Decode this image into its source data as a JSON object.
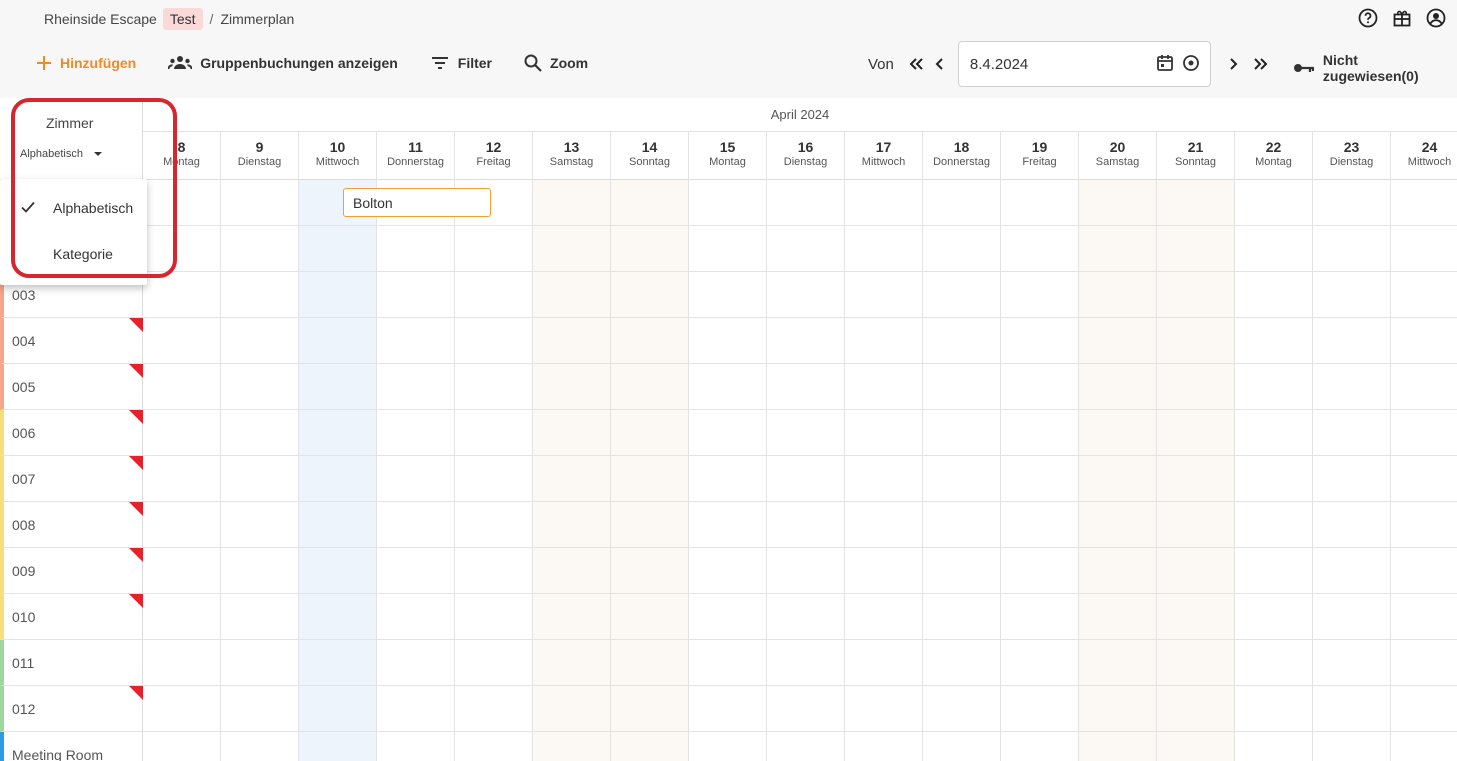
{
  "breadcrumb": {
    "org": "Rheinside Escape",
    "badge": "Test",
    "separator": "/",
    "page": "Zimmerplan"
  },
  "top_icons": [
    "help-icon",
    "gift-icon",
    "account-icon"
  ],
  "toolbar": {
    "add_label": "Hinzufügen",
    "group_label": "Gruppenbuchungen anzeigen",
    "filter_label": "Filter",
    "zoom_label": "Zoom",
    "accent_color": "#f08a24"
  },
  "datenav": {
    "from_label": "Von",
    "date_value": "8.4.2024"
  },
  "unassigned_label": "Nicht zugewiesen(0)",
  "left_header": {
    "title": "Zimmer",
    "sort_value": "Alphabetisch"
  },
  "month_label": "April 2024",
  "days": [
    {
      "num": "8",
      "wd": "Montag",
      "type": "normal"
    },
    {
      "num": "9",
      "wd": "Dienstag",
      "type": "normal"
    },
    {
      "num": "10",
      "wd": "Mittwoch",
      "type": "today"
    },
    {
      "num": "11",
      "wd": "Donnerstag",
      "type": "normal"
    },
    {
      "num": "12",
      "wd": "Freitag",
      "type": "normal"
    },
    {
      "num": "13",
      "wd": "Samstag",
      "type": "weekend"
    },
    {
      "num": "14",
      "wd": "Sonntag",
      "type": "weekend"
    },
    {
      "num": "15",
      "wd": "Montag",
      "type": "normal"
    },
    {
      "num": "16",
      "wd": "Dienstag",
      "type": "normal"
    },
    {
      "num": "17",
      "wd": "Mittwoch",
      "type": "normal"
    },
    {
      "num": "18",
      "wd": "Donnerstag",
      "type": "normal"
    },
    {
      "num": "19",
      "wd": "Freitag",
      "type": "normal"
    },
    {
      "num": "20",
      "wd": "Samstag",
      "type": "weekend"
    },
    {
      "num": "21",
      "wd": "Sonntag",
      "type": "weekend"
    },
    {
      "num": "22",
      "wd": "Montag",
      "type": "normal"
    },
    {
      "num": "23",
      "wd": "Dienstag",
      "type": "normal"
    },
    {
      "num": "24",
      "wd": "Mittwoch",
      "type": "normal"
    }
  ],
  "rooms": [
    {
      "label": "",
      "color": "#f4a58a",
      "flag": false
    },
    {
      "label": "",
      "color": "#f4a58a",
      "flag": false
    },
    {
      "label": "003",
      "color": "#f4a58a",
      "flag": false
    },
    {
      "label": "004",
      "color": "#f4a58a",
      "flag": true
    },
    {
      "label": "005",
      "color": "#f4a58a",
      "flag": true
    },
    {
      "label": "006",
      "color": "#f7de7a",
      "flag": true
    },
    {
      "label": "007",
      "color": "#f7de7a",
      "flag": true
    },
    {
      "label": "008",
      "color": "#f7de7a",
      "flag": true
    },
    {
      "label": "009",
      "color": "#f7de7a",
      "flag": true
    },
    {
      "label": "010",
      "color": "#f7de7a",
      "flag": true
    },
    {
      "label": "011",
      "color": "#9fd69f",
      "flag": false
    },
    {
      "label": "012",
      "color": "#9fd69f",
      "flag": true
    },
    {
      "label": "Meeting Room",
      "color": "#2b9be8",
      "flag": false
    }
  ],
  "booking": {
    "label": "Bolton"
  },
  "dropdown": {
    "items": [
      "Alphabetisch",
      "Kategorie"
    ],
    "selected": "Alphabetisch"
  }
}
